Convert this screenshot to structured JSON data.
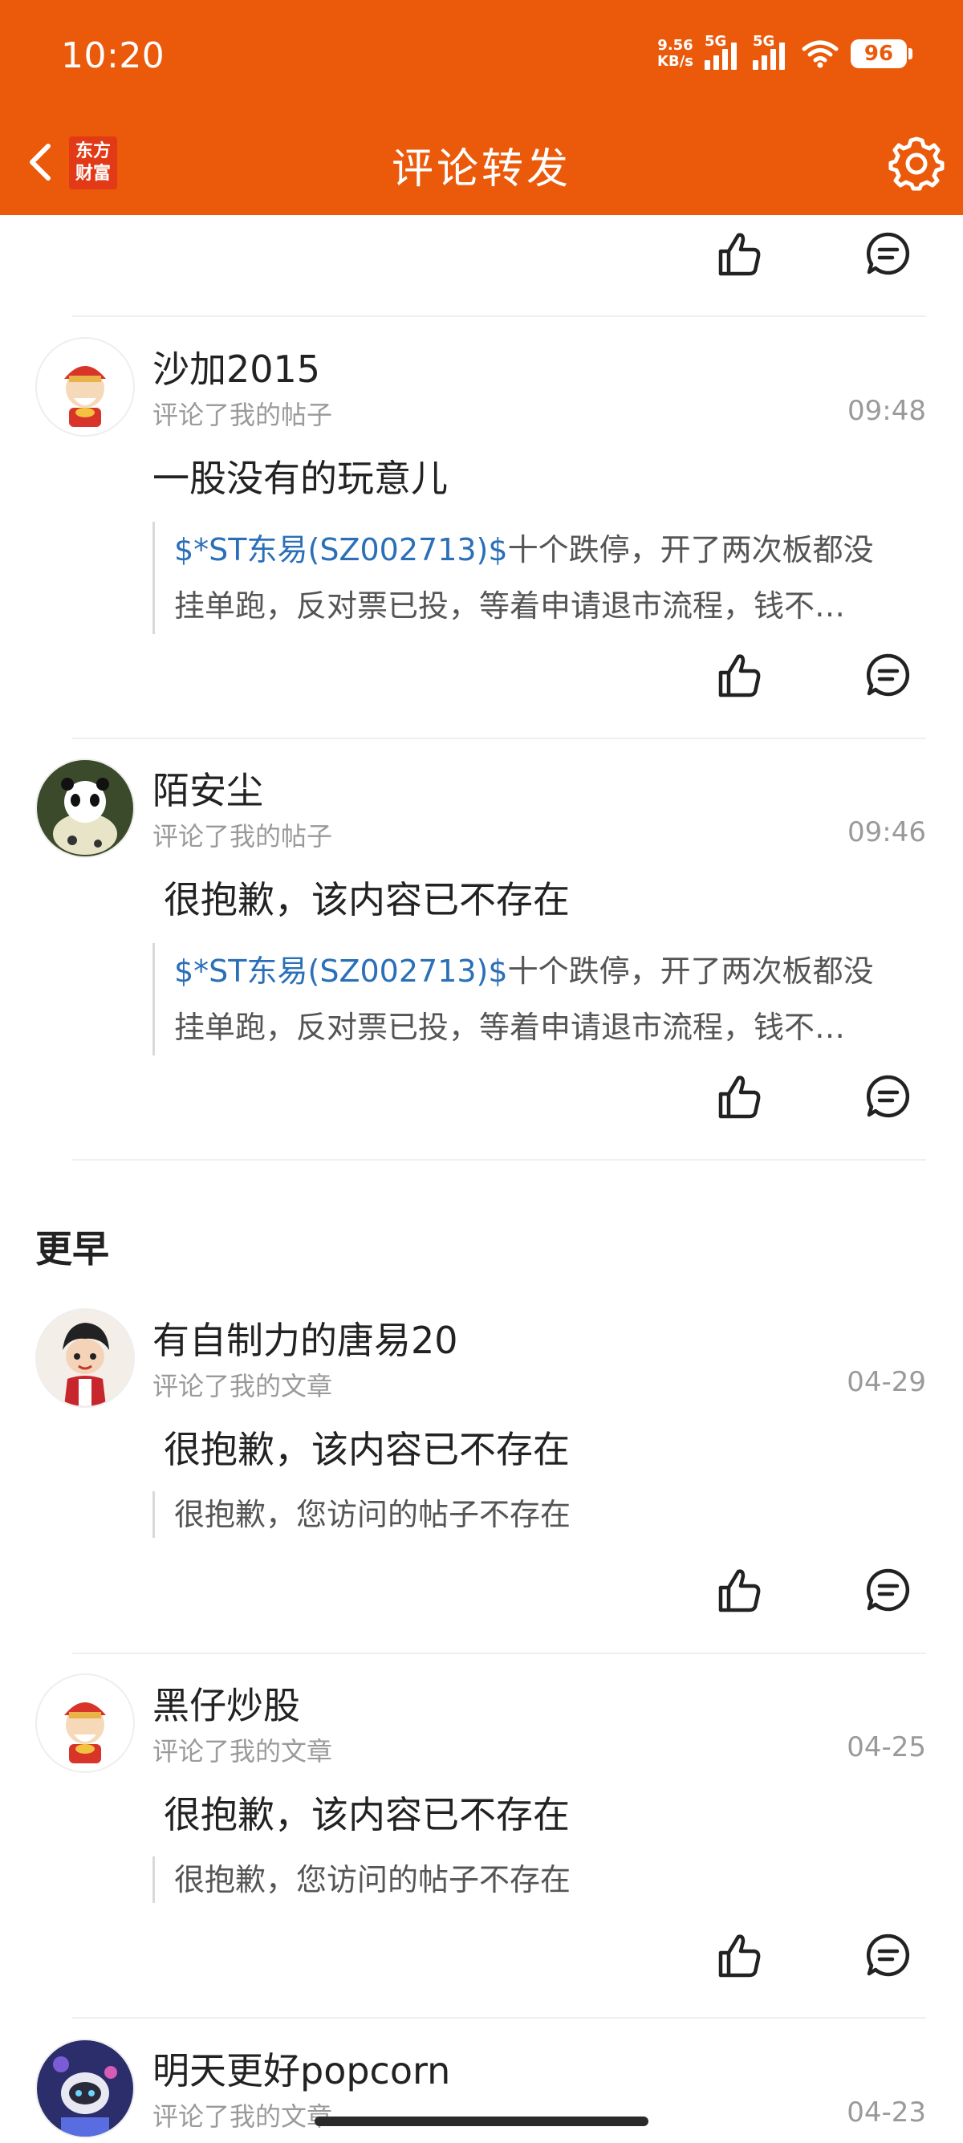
{
  "status_bar": {
    "time": "10:20",
    "net_speed_value": "9.56",
    "net_speed_unit": "KB/s",
    "signal1_tag": "5G",
    "signal2_tag": "5G",
    "battery": "96"
  },
  "header": {
    "logo_line1": "东方",
    "logo_line2": "财富",
    "title": "评论转发",
    "accent_color": "#EB5A0B"
  },
  "icons": {
    "back": "chevron-left-icon",
    "settings": "gear-icon",
    "like": "thumbs-up-icon",
    "reply": "comment-bubble-icon"
  },
  "section_earlier": "更早",
  "items": [
    {
      "name": "沙加2015",
      "action": "评论了我的帖子",
      "time": "09:48",
      "comment": "一股没有的玩意儿",
      "quote_stock": "$*ST东易(SZ002713)$",
      "quote_line1_rest": "十个跌停，开了两次板都没",
      "quote_line2": "挂单跑，反对票已投，等着申请退市流程，钱不…"
    },
    {
      "name": "陌安尘",
      "action": "评论了我的帖子",
      "time": "09:46",
      "comment": "很抱歉，该内容已不存在",
      "quote_stock": "$*ST东易(SZ002713)$",
      "quote_line1_rest": "十个跌停，开了两次板都没",
      "quote_line2": "挂单跑，反对票已投，等着申请退市流程，钱不…"
    },
    {
      "name": "有自制力的唐易20",
      "action": "评论了我的文章",
      "time": "04-29",
      "comment": "很抱歉，该内容已不存在",
      "quote": "很抱歉，您访问的帖子不存在"
    },
    {
      "name": "黑仔炒股",
      "action": "评论了我的文章",
      "time": "04-25",
      "comment": "很抱歉，该内容已不存在",
      "quote": "很抱歉，您访问的帖子不存在"
    },
    {
      "name": "明天更好popcorn",
      "action": "评论了我的文章",
      "time": "04-23"
    }
  ]
}
